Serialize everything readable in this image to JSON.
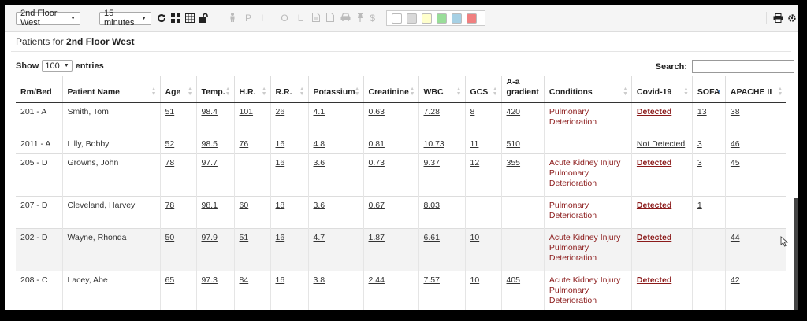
{
  "toolbar": {
    "unit_select": "2nd Floor West",
    "interval_select": "15 minutes",
    "icons": [
      "refresh-icon",
      "grid-icon",
      "table-icon",
      "unlock-icon",
      "person-icon",
      "print-icon",
      "gear-icon"
    ],
    "letters": [
      "P",
      "I",
      "O",
      "L"
    ],
    "dollar": "$",
    "swatches": [
      "#ffffff",
      "#d9d9d9",
      "#ffffcc",
      "#99dd99",
      "#a6d0e4",
      "#f08080"
    ]
  },
  "heading": {
    "prefix": "Patients for",
    "unit": "2nd Floor West"
  },
  "controls": {
    "show_label": "Show",
    "page_size": "100",
    "entries_label": "entries",
    "search_label": "Search:",
    "search_value": ""
  },
  "table": {
    "headers": [
      "Rm/Bed",
      "Patient Name",
      "Age",
      "Temp.",
      "H.R.",
      "R.R.",
      "Potassium",
      "Creatinine",
      "WBC",
      "GCS",
      "A-a gradient",
      "Conditions",
      "Covid-19",
      "SOFA",
      "APACHE II"
    ],
    "rows": [
      {
        "bed": "201 - A",
        "name": "Smith, Tom",
        "age": "51",
        "temp": "98.4",
        "hr": "101",
        "rr": "26",
        "k": "4.1",
        "cr": "0.63",
        "wbc": "7.28",
        "gcs": "8",
        "aa": "420",
        "cond1": "Pulmonary",
        "cond2": "Deterioration",
        "cond3": "",
        "covid": "Detected",
        "sofa": "13",
        "apache": "38"
      },
      {
        "bed": "2011 - A",
        "name": "Lilly, Bobby",
        "age": "52",
        "temp": "98.5",
        "hr": "76",
        "rr": "16",
        "k": "4.8",
        "cr": "0.81",
        "wbc": "10.73",
        "gcs": "11",
        "aa": "510",
        "cond1": "",
        "cond2": "",
        "cond3": "",
        "covid": "Not Detected",
        "sofa": "3",
        "apache": "46"
      },
      {
        "bed": "205 - D",
        "name": "Growns, John",
        "age": "78",
        "temp": "97.7",
        "hr": "",
        "rr": "16",
        "k": "3.6",
        "cr": "0.73",
        "wbc": "9.37",
        "gcs": "12",
        "aa": "355",
        "cond1": "Acute Kidney Injury",
        "cond2": "Pulmonary",
        "cond3": "Deterioration",
        "covid": "Detected",
        "sofa": "3",
        "apache": "45"
      },
      {
        "bed": "207 - D",
        "name": "Cleveland, Harvey",
        "age": "78",
        "temp": "98.1",
        "hr": "60",
        "rr": "18",
        "k": "3.6",
        "cr": "0.67",
        "wbc": "8.03",
        "gcs": "",
        "aa": "",
        "cond1": "Pulmonary",
        "cond2": "Deterioration",
        "cond3": "",
        "covid": "Detected",
        "sofa": "1",
        "apache": ""
      },
      {
        "bed": "202 - D",
        "name": "Wayne, Rhonda",
        "age": "50",
        "temp": "97.9",
        "hr": "51",
        "rr": "16",
        "k": "4.7",
        "cr": "1.87",
        "wbc": "6.61",
        "gcs": "10",
        "aa": "",
        "cond1": "Acute Kidney Injury",
        "cond2": "Pulmonary",
        "cond3": "Deterioration",
        "covid": "Detected",
        "sofa": "",
        "apache": "44"
      },
      {
        "bed": "208 - C",
        "name": "Lacey, Abe",
        "age": "65",
        "temp": "97.3",
        "hr": "84",
        "rr": "16",
        "k": "3.8",
        "cr": "2.44",
        "wbc": "7.57",
        "gcs": "10",
        "aa": "405",
        "cond1": "Acute Kidney Injury",
        "cond2": "Pulmonary",
        "cond3": "Deterioration",
        "covid": "Detected",
        "sofa": "",
        "apache": "42"
      }
    ]
  }
}
